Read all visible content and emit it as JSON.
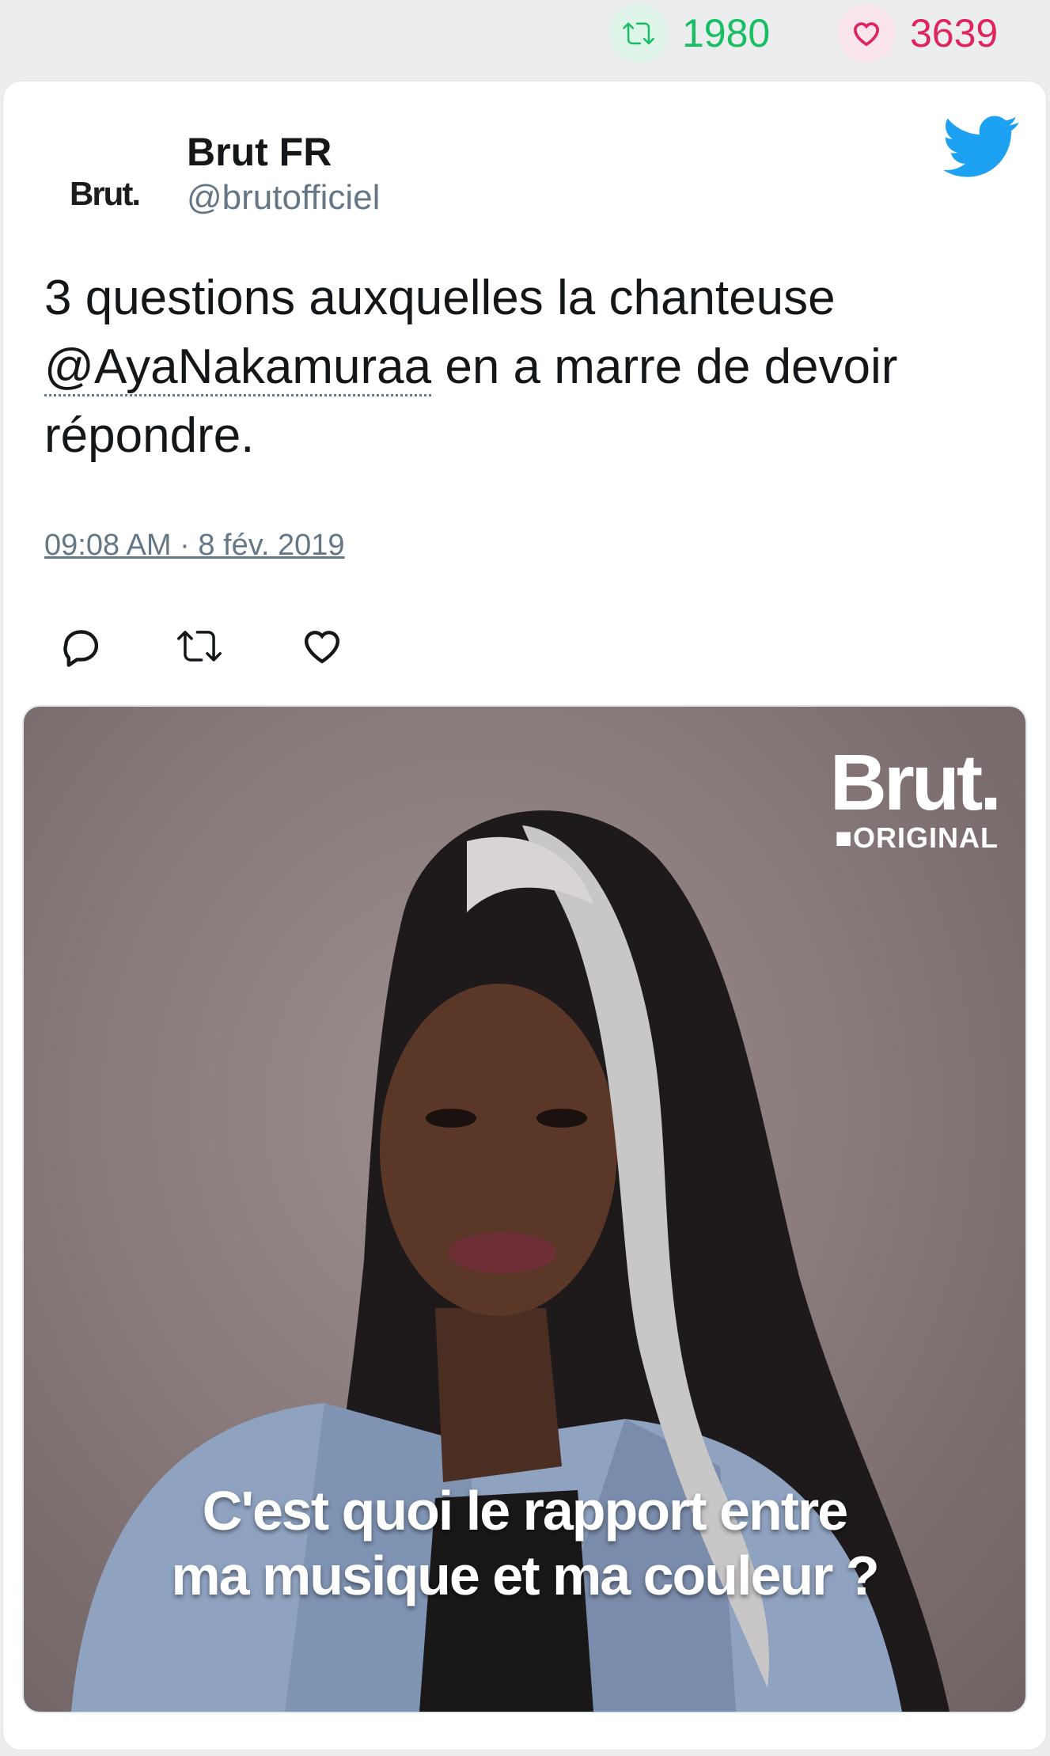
{
  "stats": {
    "retweets": "1980",
    "likes": "3639",
    "retweet_color": "#17bf63",
    "like_color": "#e0245e"
  },
  "tweet": {
    "author_name": "Brut FR",
    "author_handle": "@brutofficiel",
    "avatar_text": "Brut.",
    "text_before": "3 questions auxquelles la chanteuse ",
    "mention": "@AyaNakamuraa",
    "text_after": " en a marre de devoir répondre.",
    "timestamp": "09:08 AM · 8 fév. 2019"
  },
  "actions": {
    "reply_icon": "reply-icon",
    "retweet_icon": "retweet-icon",
    "like_icon": "like-icon"
  },
  "media": {
    "watermark_brand": "Brut.",
    "watermark_sub": "■ORIGINAL",
    "caption_line1": "C'est quoi le rapport entre",
    "caption_line2": "ma musique et ma couleur ?"
  }
}
